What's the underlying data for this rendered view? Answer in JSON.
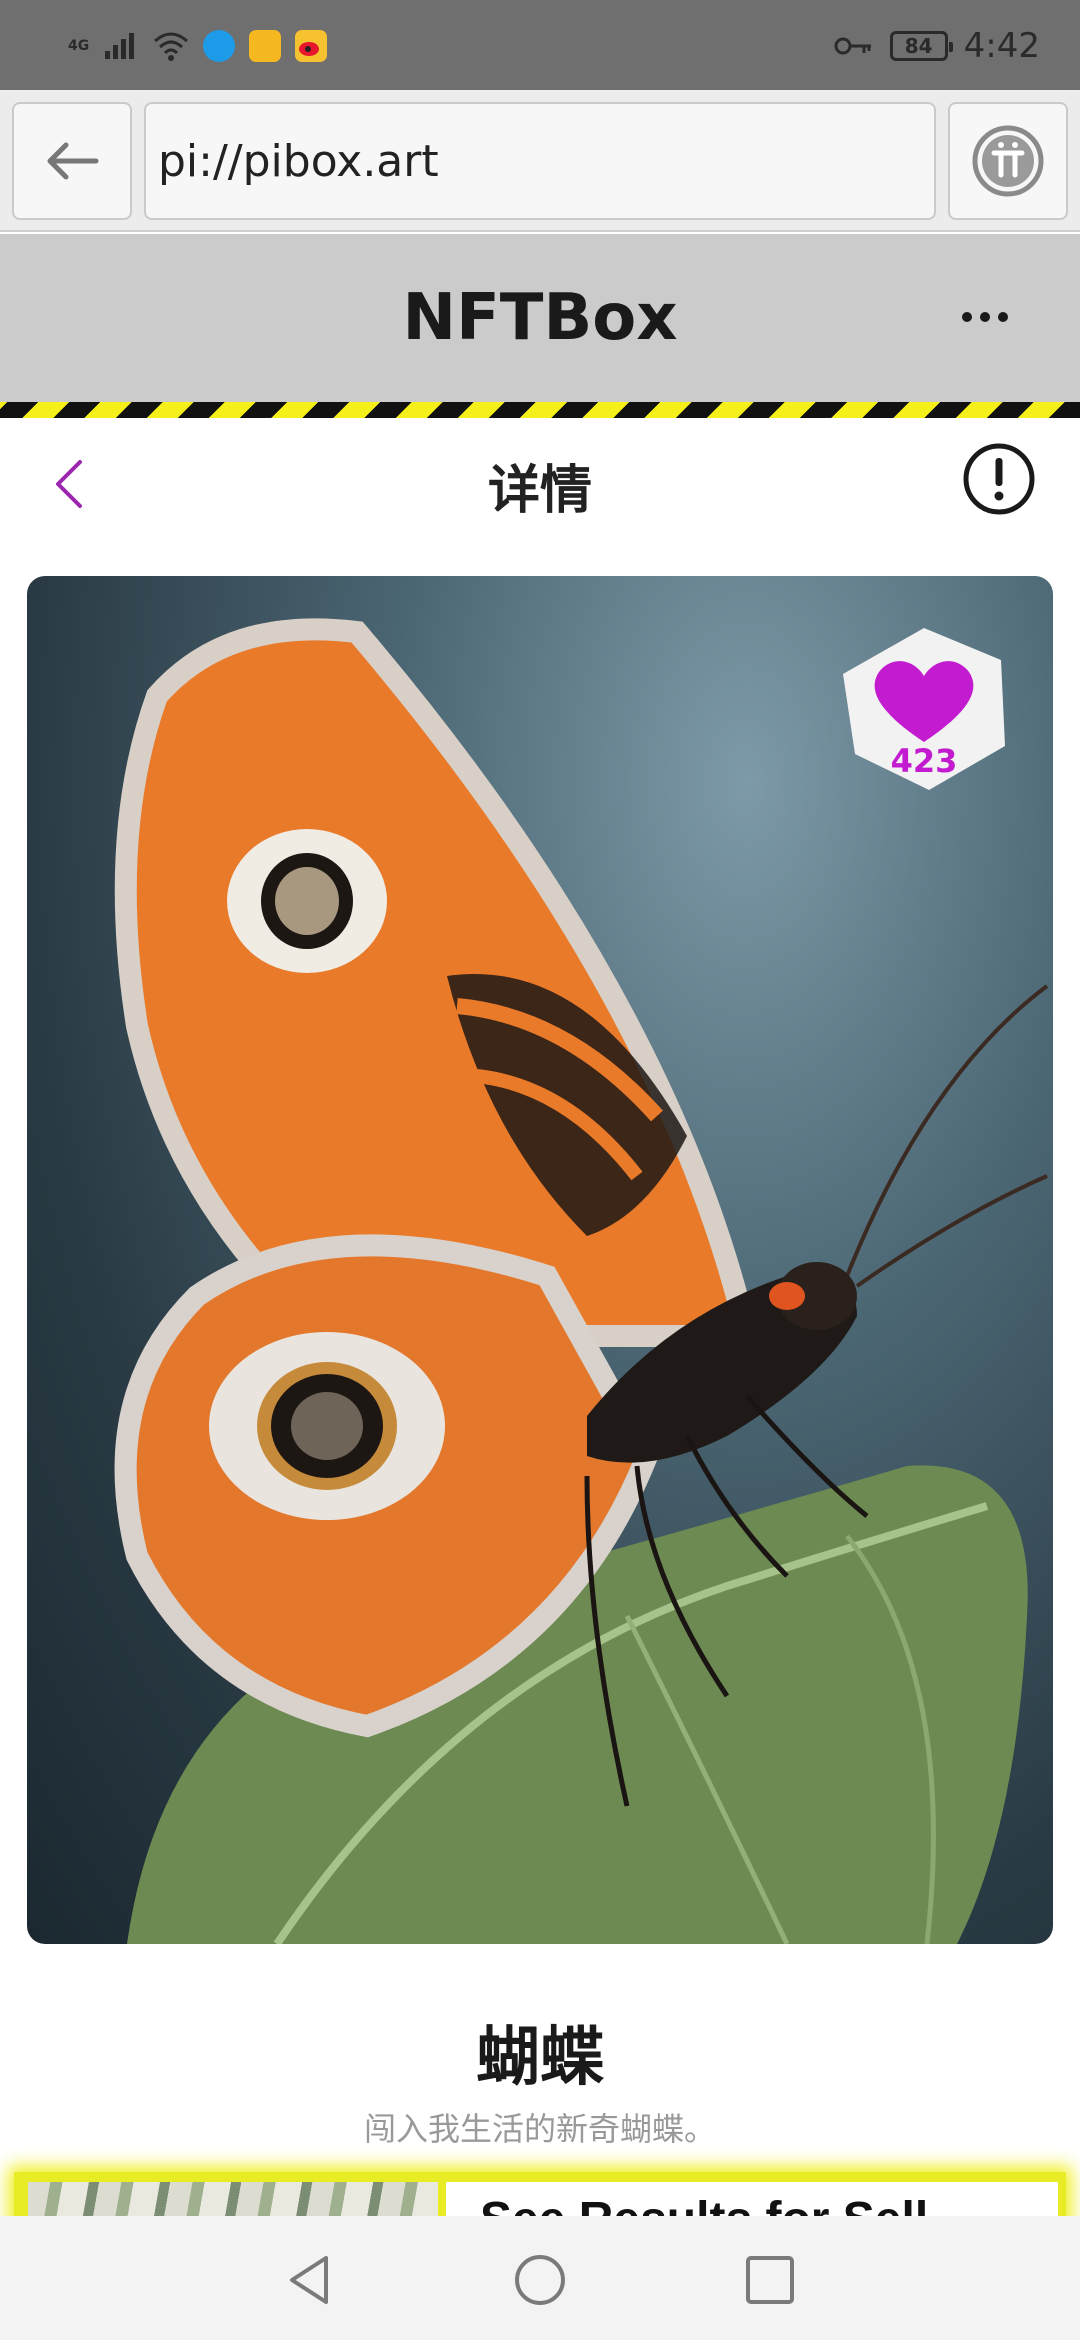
{
  "status_bar": {
    "network": "4G",
    "battery": "84",
    "time": "4:42",
    "icons": [
      "signal-icon",
      "wifi-icon",
      "app-icon-blue",
      "app-icon-yellow",
      "weibo-icon",
      "key-icon",
      "battery-icon"
    ]
  },
  "browser": {
    "url": "pi://pibox.art"
  },
  "app_header": {
    "title": "NFTBox"
  },
  "page": {
    "title": "详情"
  },
  "nft": {
    "likes": "423",
    "name": "蝴蝶",
    "description": "闯入我生活的新奇蝴蝶。"
  },
  "ad": {
    "text": "See Results for Sell"
  },
  "colors": {
    "accent": "#9b27b0",
    "heart": "#c21bd0",
    "hazard_yellow": "#f5ef1a",
    "header_bg": "#cbcbcb"
  }
}
